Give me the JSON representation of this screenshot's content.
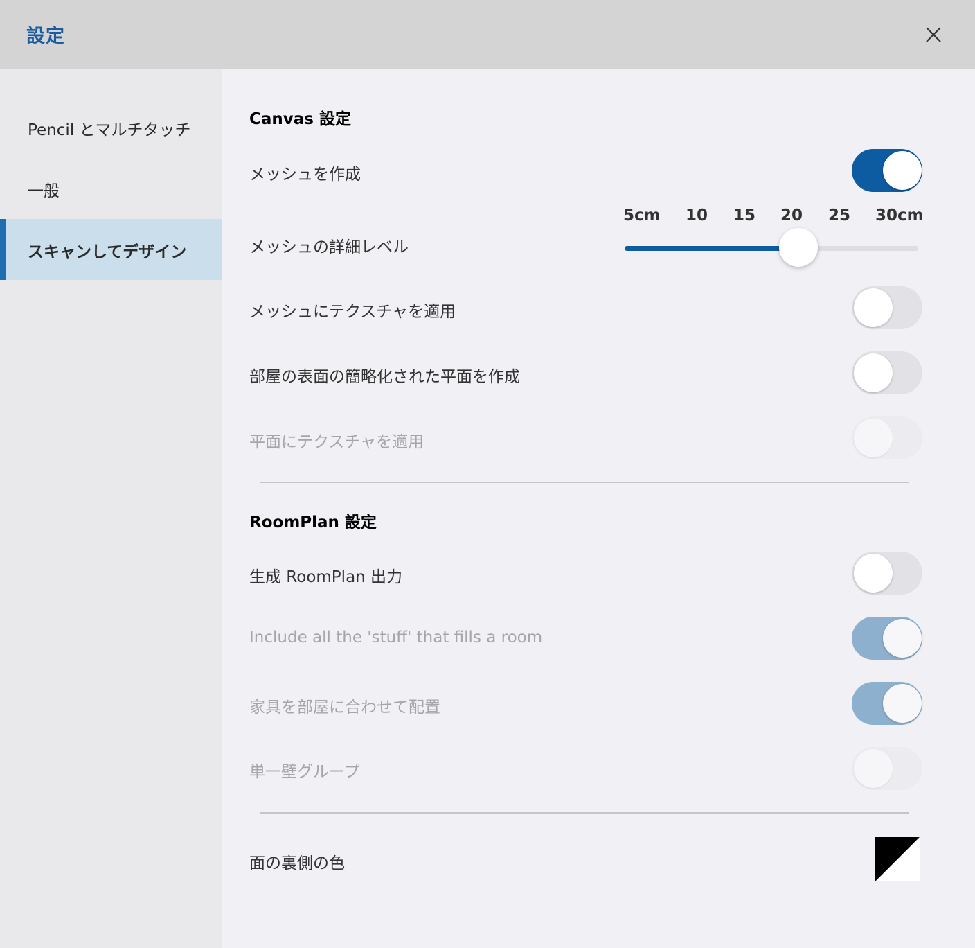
{
  "header": {
    "title": "設定"
  },
  "sidebar": {
    "items": [
      {
        "label": "Pencil とマルチタッチ"
      },
      {
        "label": "一般"
      },
      {
        "label": "スキャンしてデザイン"
      }
    ]
  },
  "canvas": {
    "title": "Canvas 設定",
    "create_mesh": {
      "label": "メッシュを作成",
      "state": "on"
    },
    "mesh_detail": {
      "label": "メッシュの詳細レベル",
      "ticks": [
        "5cm",
        "10",
        "15",
        "20",
        "25",
        "30cm"
      ],
      "value_cm": 20,
      "fill_fraction": 0.58
    },
    "apply_texture_mesh": {
      "label": "メッシュにテクスチャを適用",
      "state": "off"
    },
    "simplified_planes": {
      "label": "部屋の表面の簡略化された平面を作成",
      "state": "off"
    },
    "apply_texture_planes": {
      "label": "平面にテクスチャを適用",
      "state": "off-disabled"
    }
  },
  "roomplan": {
    "title": "RoomPlan 設定",
    "generate_output": {
      "label": "生成 RoomPlan 出力",
      "state": "off"
    },
    "include_stuff": {
      "label": "Include all the 'stuff' that fills a room",
      "state": "on-disabled"
    },
    "fit_furniture": {
      "label": "家具を部屋に合わせて配置",
      "state": "on-disabled"
    },
    "single_wall_group": {
      "label": "単一壁グループ",
      "state": "off-disabled"
    }
  },
  "backface": {
    "label": "面の裏側の色",
    "colors": [
      "#000000",
      "#ffffff"
    ]
  },
  "colors": {
    "accent": "#0d5ba1",
    "header_title": "#1a5c9e",
    "sidebar_active": "#cadeeb"
  }
}
